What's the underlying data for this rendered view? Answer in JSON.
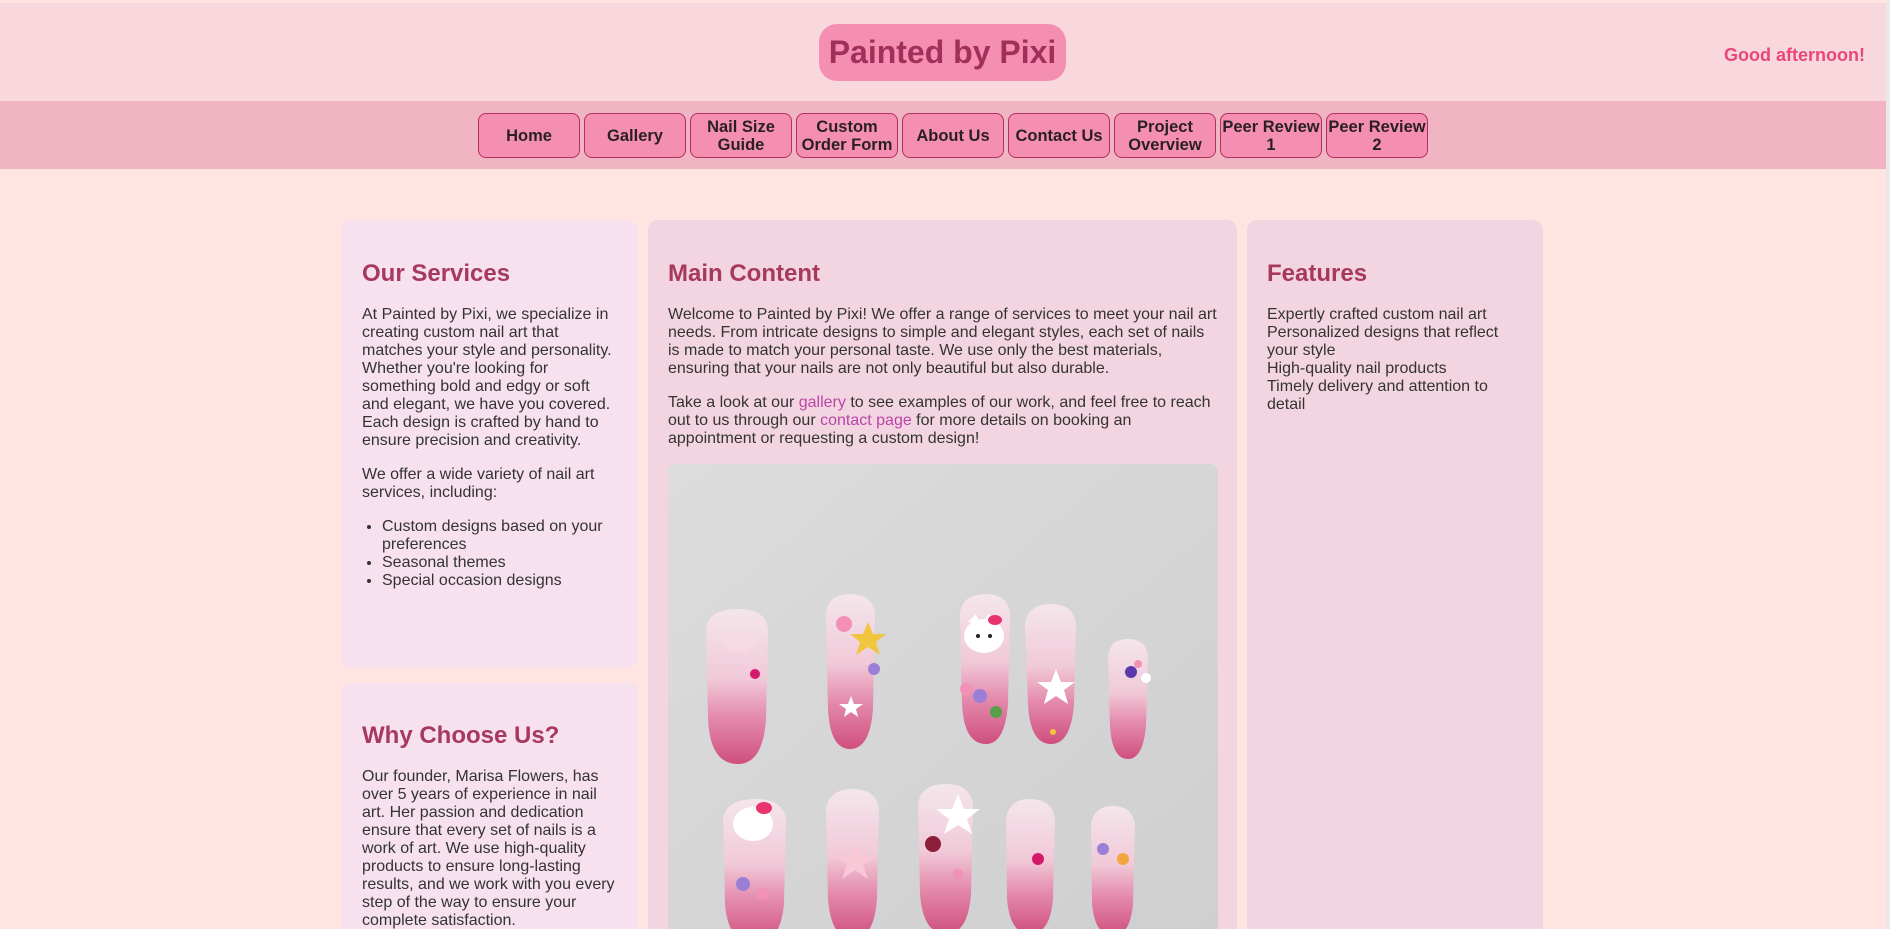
{
  "site": {
    "brand": "Painted by Pixi",
    "greeting": "Good afternoon!"
  },
  "nav": [
    {
      "label": "Home"
    },
    {
      "label": "Gallery"
    },
    {
      "label": "Nail Size Guide"
    },
    {
      "label": "Custom Order Form"
    },
    {
      "label": "About Us"
    },
    {
      "label": "Contact Us"
    },
    {
      "label": "Project Overview"
    },
    {
      "label": "Peer Review 1"
    },
    {
      "label": "Peer Review 2"
    }
  ],
  "services": {
    "heading": "Our Services",
    "p1": "At Painted by Pixi, we specialize in creating custom nail art that matches your style and personality. Whether you're looking for something bold and edgy or soft and elegant, we have you covered. Each design is crafted by hand to ensure precision and creativity.",
    "p2": "We offer a wide variety of nail art services, including:",
    "items": [
      "Custom designs based on your preferences",
      "Seasonal themes",
      "Special occasion designs"
    ]
  },
  "why": {
    "heading": "Why Choose Us?",
    "p1": "Our founder, Marisa Flowers, has over 5 years of experience in nail art. Her passion and dedication ensure that every set of nails is a work of art. We use high-quality products to ensure long-lasting results, and we work with you every step of the way to ensure your complete satisfaction."
  },
  "main": {
    "heading": "Main Content",
    "p1": "Welcome to Painted by Pixi! We offer a range of services to meet your nail art needs. From intricate designs to simple and elegant styles, each set of nails is made to match your personal taste. We use only the best materials, ensuring that your nails are not only beautiful but also durable.",
    "p2_before": "Take a look at our ",
    "gallery_link": "gallery",
    "p2_mid": " to see examples of our work, and feel free to reach out to us through our ",
    "contact_link": "contact page",
    "p2_after": " for more details on booking an appointment or requesting a custom design!"
  },
  "features": {
    "heading": "Features",
    "items": [
      "Expertly crafted custom nail art",
      "Personalized designs that reflect your style",
      "High-quality nail products",
      "Timely delivery and attention to detail"
    ]
  },
  "colors": {
    "page_bg": "#ffe4e1",
    "header_bg": "#f8d7dd",
    "nav_bg": "#f1b4c2",
    "button_bg": "#f48fb1",
    "heading": "#a7385e",
    "greeting": "#e8467c",
    "link": "#b945a8"
  }
}
